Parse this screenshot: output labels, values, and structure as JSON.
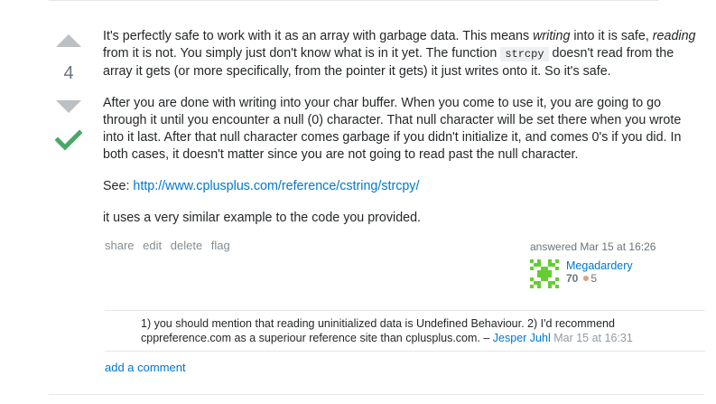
{
  "vote": {
    "count": "4"
  },
  "colors": {
    "accent": "#0077cc",
    "accepted": "#48a868",
    "vote_arrow": "#bbc0c4"
  },
  "post": {
    "p1_a": "It's perfectly safe to work with it as an array with garbage data. This means ",
    "p1_em1": "writing",
    "p1_b": " into it is safe, ",
    "p1_em2": "reading",
    "p1_c": " from it is not. You simply just don't know what is in it yet. The function ",
    "p1_code": "strcpy",
    "p1_d": " doesn't read from the array it gets (or more specifically, from the pointer it gets) it just writes onto it. So it's safe.",
    "p2": "After you are done with writing into your char buffer. When you come to use it, you are going to go through it until you encounter a null (0) character. That null character will be set there when you wrote into it last. After that null character comes garbage if you didn't initialize it, and comes 0's if you did. In both cases, it doesn't matter since you are not going to read past the null character.",
    "p3_label": "See: ",
    "p3_link": "http://www.cplusplus.com/reference/cstring/strcpy/",
    "p4": "it uses a very similar example to the code you provided."
  },
  "menu": {
    "share": "share",
    "edit": "edit",
    "delete": "delete",
    "flag": "flag"
  },
  "user": {
    "action": "answered",
    "time": "Mar 15 at 16:26",
    "name": "Megadardery",
    "rep": "70",
    "bronze": "5"
  },
  "comments": [
    {
      "text": "1) you should mention that reading uninitialized data is Undefined Behaviour. 2) I'd recommend cppreference.com as a superiour reference site than cplusplus.com.",
      "dash": " – ",
      "user": "Jesper Juhl",
      "date": "Mar 15 at 16:31"
    }
  ],
  "add_comment": "add a comment"
}
